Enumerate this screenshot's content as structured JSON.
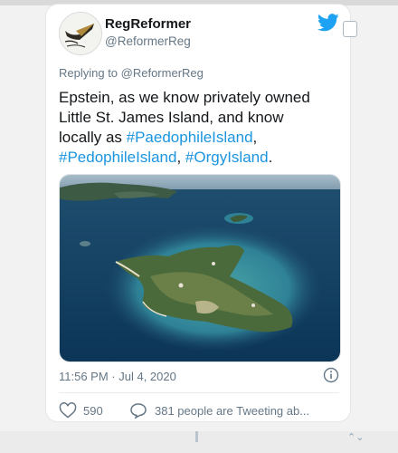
{
  "tweet": {
    "display_name": "RegReformer",
    "handle": "@ReformerReg",
    "replying_to": "Replying to @ReformerReg",
    "text_parts": [
      "Epstein, as we know privately owned Little St. James Island, and know locally as ",
      "#PaedophileIsland",
      ", ",
      "#PedophileIsland",
      ", ",
      "#OrgyIsland",
      "."
    ],
    "timestamp": "11:56 PM · Jul 4, 2020",
    "likes": "590",
    "tweeting": "381 people are Tweeting ab..."
  },
  "icons": {
    "brand": "twitter-bird-icon",
    "info": "info-icon",
    "like": "heart-icon",
    "reply": "speech-bubble-icon"
  },
  "colors": {
    "link": "#1b95e0",
    "brand": "#1da1f2",
    "text": "#14171a",
    "muted": "#657786"
  }
}
